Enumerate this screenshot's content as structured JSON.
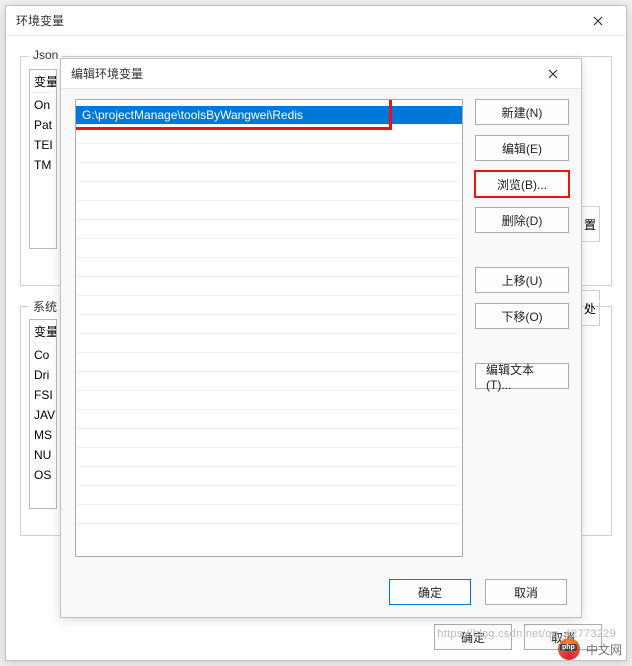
{
  "bgwin": {
    "title": "环境变量",
    "group1_label": "Json",
    "group2_label": "系统",
    "list1": {
      "header": "变量",
      "items": [
        "On",
        "Pat",
        "TEI",
        "TM"
      ]
    },
    "list2": {
      "header": "变量",
      "items": [
        "Co",
        "Dri",
        "FSI",
        "JAV",
        "MS",
        "NU",
        "OS"
      ]
    },
    "side": {
      "a": "置",
      "b": "处"
    },
    "ok": "确定",
    "cancel": "取消"
  },
  "dlg": {
    "title": "编辑环境变量",
    "selected_path": "G:\\projectManage\\toolsByWangwei\\Redis",
    "buttons": {
      "new": "新建(N)",
      "edit": "编辑(E)",
      "browse": "浏览(B)...",
      "delete": "删除(D)",
      "moveup": "上移(U)",
      "movedown": "下移(O)",
      "edittext": "编辑文本(T)..."
    },
    "ok": "确定",
    "cancel": "取消"
  },
  "watermark": {
    "sub": "https://blog.csdn.net/qq_42773229",
    "text": "中文网",
    "php": "php"
  }
}
